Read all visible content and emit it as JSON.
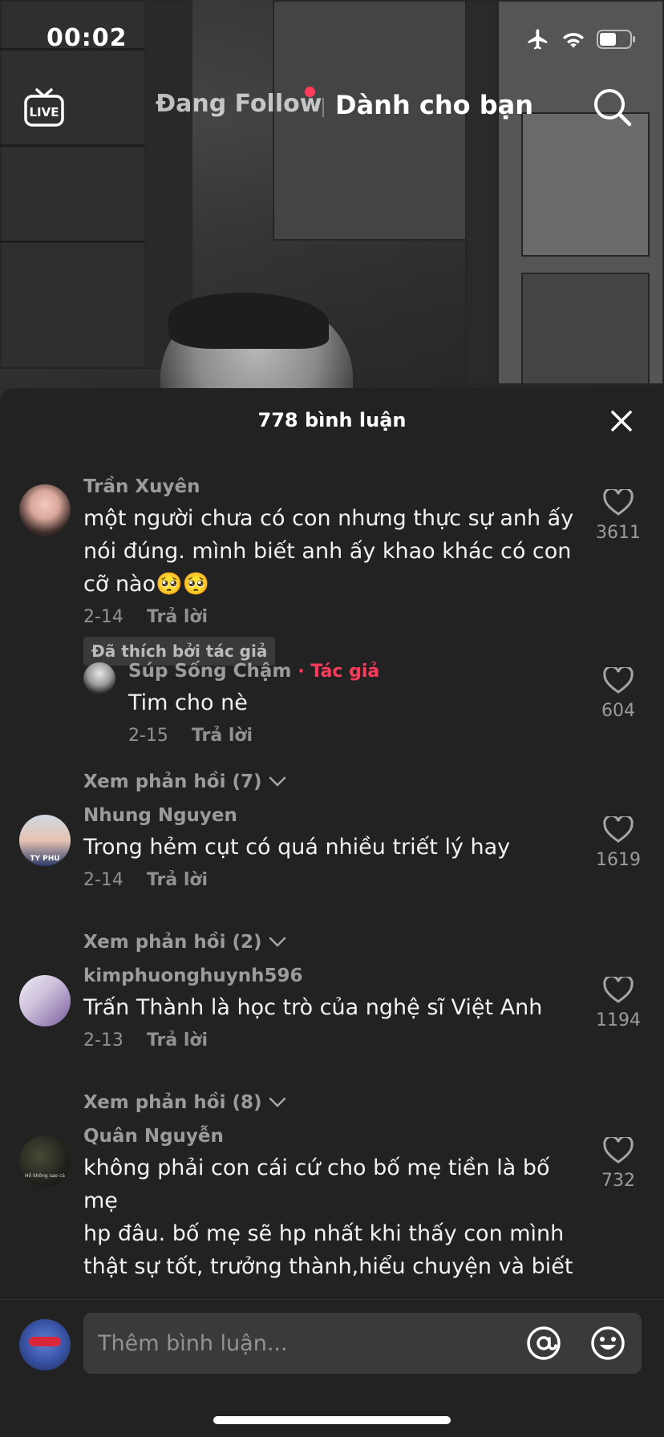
{
  "status_bar": {
    "time": "00:02"
  },
  "top_nav": {
    "following_label": "Đang Follow",
    "for_you_label": "Dành cho bạn",
    "live_label": "LIVE"
  },
  "sheet": {
    "title": "778 bình luận",
    "comments": [
      {
        "username": "Trần Xuyên",
        "lines": [
          "một người chưa có con nhưng thực sự anh ấy",
          "nói đúng. mình biết anh ấy khao khác có con",
          "cỡ nào🥺🥺"
        ],
        "date": "2-14",
        "reply_label": "Trả lời",
        "badge": "Đã thích bởi tác giả",
        "likes": "3611"
      },
      {
        "username": "Súp Sống Chậm",
        "author_tag": "· Tác giả",
        "lines": [
          "Tim cho nè"
        ],
        "date": "2-15",
        "reply_label": "Trả lời",
        "likes": "604"
      },
      {
        "username": "Nhung Nguyen",
        "lines": [
          "Trong hẻm cụt có quá nhiều triết lý hay"
        ],
        "date": "2-14",
        "reply_label": "Trả lời",
        "likes": "1619"
      },
      {
        "username": "kimphuonghuynh596",
        "lines": [
          "Trấn Thành là học trò của nghệ sĩ Việt Anh"
        ],
        "date": "2-13",
        "reply_label": "Trả lời",
        "likes": "1194"
      },
      {
        "username": "Quân Nguyễn",
        "lines": [
          "không phải con cái cứ cho bố mẹ tiền là bố mẹ",
          "hp đâu. bố mẹ sẽ hp nhất khi thấy con mình",
          "thật sự tốt, trưởng thành,hiểu chuyện và biết"
        ],
        "likes": "732"
      }
    ],
    "view_replies": [
      "Xem phản hồi (7)",
      "Xem phản hồi (2)",
      "Xem phản hồi (8)"
    ],
    "avatar_texts": {
      "nhung": "TY PHU",
      "quan": "Hồ không sao cả"
    }
  },
  "input": {
    "placeholder": "Thêm bình luận..."
  },
  "colors": {
    "accent": "#ff3b5c",
    "sheet_bg": "#222222",
    "input_bg": "#3a3a3a"
  }
}
